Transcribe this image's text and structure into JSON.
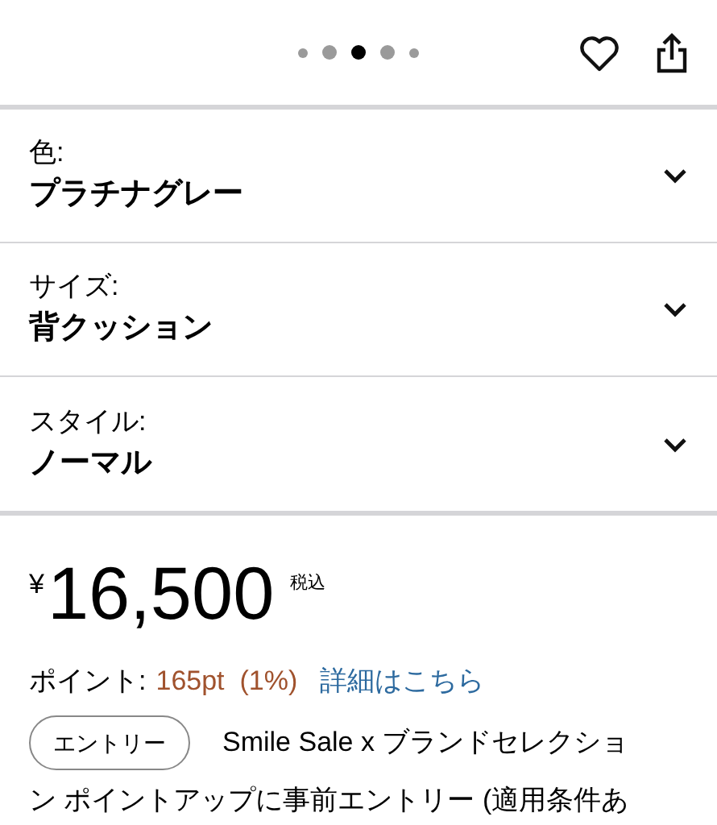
{
  "carousel_dots": [
    {
      "selected": false
    },
    {
      "selected": false
    },
    {
      "selected": true
    },
    {
      "selected": false
    },
    {
      "selected": false
    }
  ],
  "options": [
    {
      "label": "色:",
      "value": "プラチナグレー"
    },
    {
      "label": "サイズ:",
      "value": "背クッション"
    },
    {
      "label": "スタイル:",
      "value": "ノーマル"
    }
  ],
  "price": {
    "currency": "¥",
    "amount": "16,500",
    "tax_note": "税込"
  },
  "points": {
    "label": "ポイント:",
    "value": "165pt  (1%)",
    "link": "詳細はこちら"
  },
  "promo": {
    "button": "エントリー",
    "lines": [
      "Smile Sale x ブランドセレクショ",
      "ン ポイントアップに事前エントリー (適用条件あ"
    ]
  }
}
